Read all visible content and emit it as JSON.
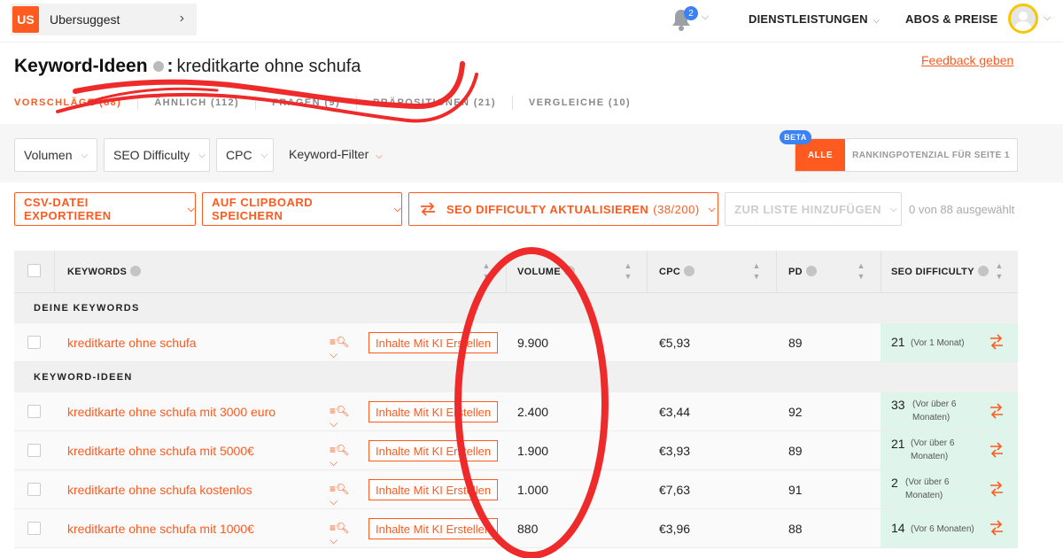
{
  "header": {
    "brand_logo": "US",
    "brand_name": "Ubersuggest",
    "notification_count": "2",
    "nav": [
      {
        "label": "DIENSTLEISTUNGEN"
      },
      {
        "label": "ABOS & PREISE"
      }
    ]
  },
  "title": {
    "label": "Keyword-Ideen",
    "colon": ":",
    "query": "kreditkarte ohne schufa",
    "feedback": "Feedback geben"
  },
  "tabs": [
    {
      "label": "VORSCHLÄGE (88)",
      "active": true
    },
    {
      "label": "ÄHNLICH (112)",
      "active": false
    },
    {
      "label": "FRAGEN (9)",
      "active": false
    },
    {
      "label": "PRÄPOSITIONEN (21)",
      "active": false
    },
    {
      "label": "VERGLEICHE (10)",
      "active": false
    }
  ],
  "filters": {
    "volume": "Volumen",
    "seo_difficulty": "SEO Difficulty",
    "cpc": "CPC",
    "keyword_filter": "Keyword-Filter",
    "beta": "BETA",
    "toggle_all": "ALLE",
    "toggle_rank": "RANKINGPOTENZIAL FÜR SEITE 1"
  },
  "actions": {
    "csv": "CSV-DATEI EXPORTIEREN",
    "clipboard": "AUF CLIPBOARD SPEICHERN",
    "seo_update": "SEO DIFFICULTY AKTUALISIEREN",
    "seo_update_count": "(38/200)",
    "add_list": "ZUR LISTE HINZUFÜGEN",
    "selected": "0 von 88 ausgewählt"
  },
  "table": {
    "columns": {
      "keywords": "KEYWORDS",
      "volume": "VOLUME",
      "cpc": "CPC",
      "pd": "PD",
      "seo": "SEO DIFFICULTY"
    },
    "section_own": "DEINE KEYWORDS",
    "section_ideas": "KEYWORD-IDEEN",
    "ki_button": "Inhalte Mit KI Erstellen",
    "own_rows": [
      {
        "keyword": "kreditkarte ohne schufa",
        "volume": "9.900",
        "cpc": "€5,93",
        "pd": "89",
        "seo": "21",
        "seo_note": "(Vor 1 Monat)"
      }
    ],
    "idea_rows": [
      {
        "keyword": "kreditkarte ohne schufa mit 3000 euro",
        "volume": "2.400",
        "cpc": "€3,44",
        "pd": "92",
        "seo": "33",
        "seo_note_1": "(Vor über 6",
        "seo_note_2": "Monaten)"
      },
      {
        "keyword": "kreditkarte ohne schufa mit 5000€",
        "volume": "1.900",
        "cpc": "€3,93",
        "pd": "89",
        "seo": "21",
        "seo_note_1": "(Vor über 6",
        "seo_note_2": "Monaten)"
      },
      {
        "keyword": "kreditkarte ohne schufa kostenlos",
        "volume": "1.000",
        "cpc": "€7,63",
        "pd": "91",
        "seo": "2",
        "seo_note_1": "(Vor über 6",
        "seo_note_2": "Monaten)"
      },
      {
        "keyword": "kreditkarte ohne schufa mit 1000€",
        "volume": "880",
        "cpc": "€3,96",
        "pd": "88",
        "seo": "14",
        "seo_note_1": "(Vor 6 Monaten)",
        "seo_note_2": ""
      }
    ]
  },
  "colors": {
    "accent": "#ff5a1f",
    "seo_cell": "#dff4ea",
    "annotation": "#ee2a2a",
    "beta": "#3b82f6"
  }
}
